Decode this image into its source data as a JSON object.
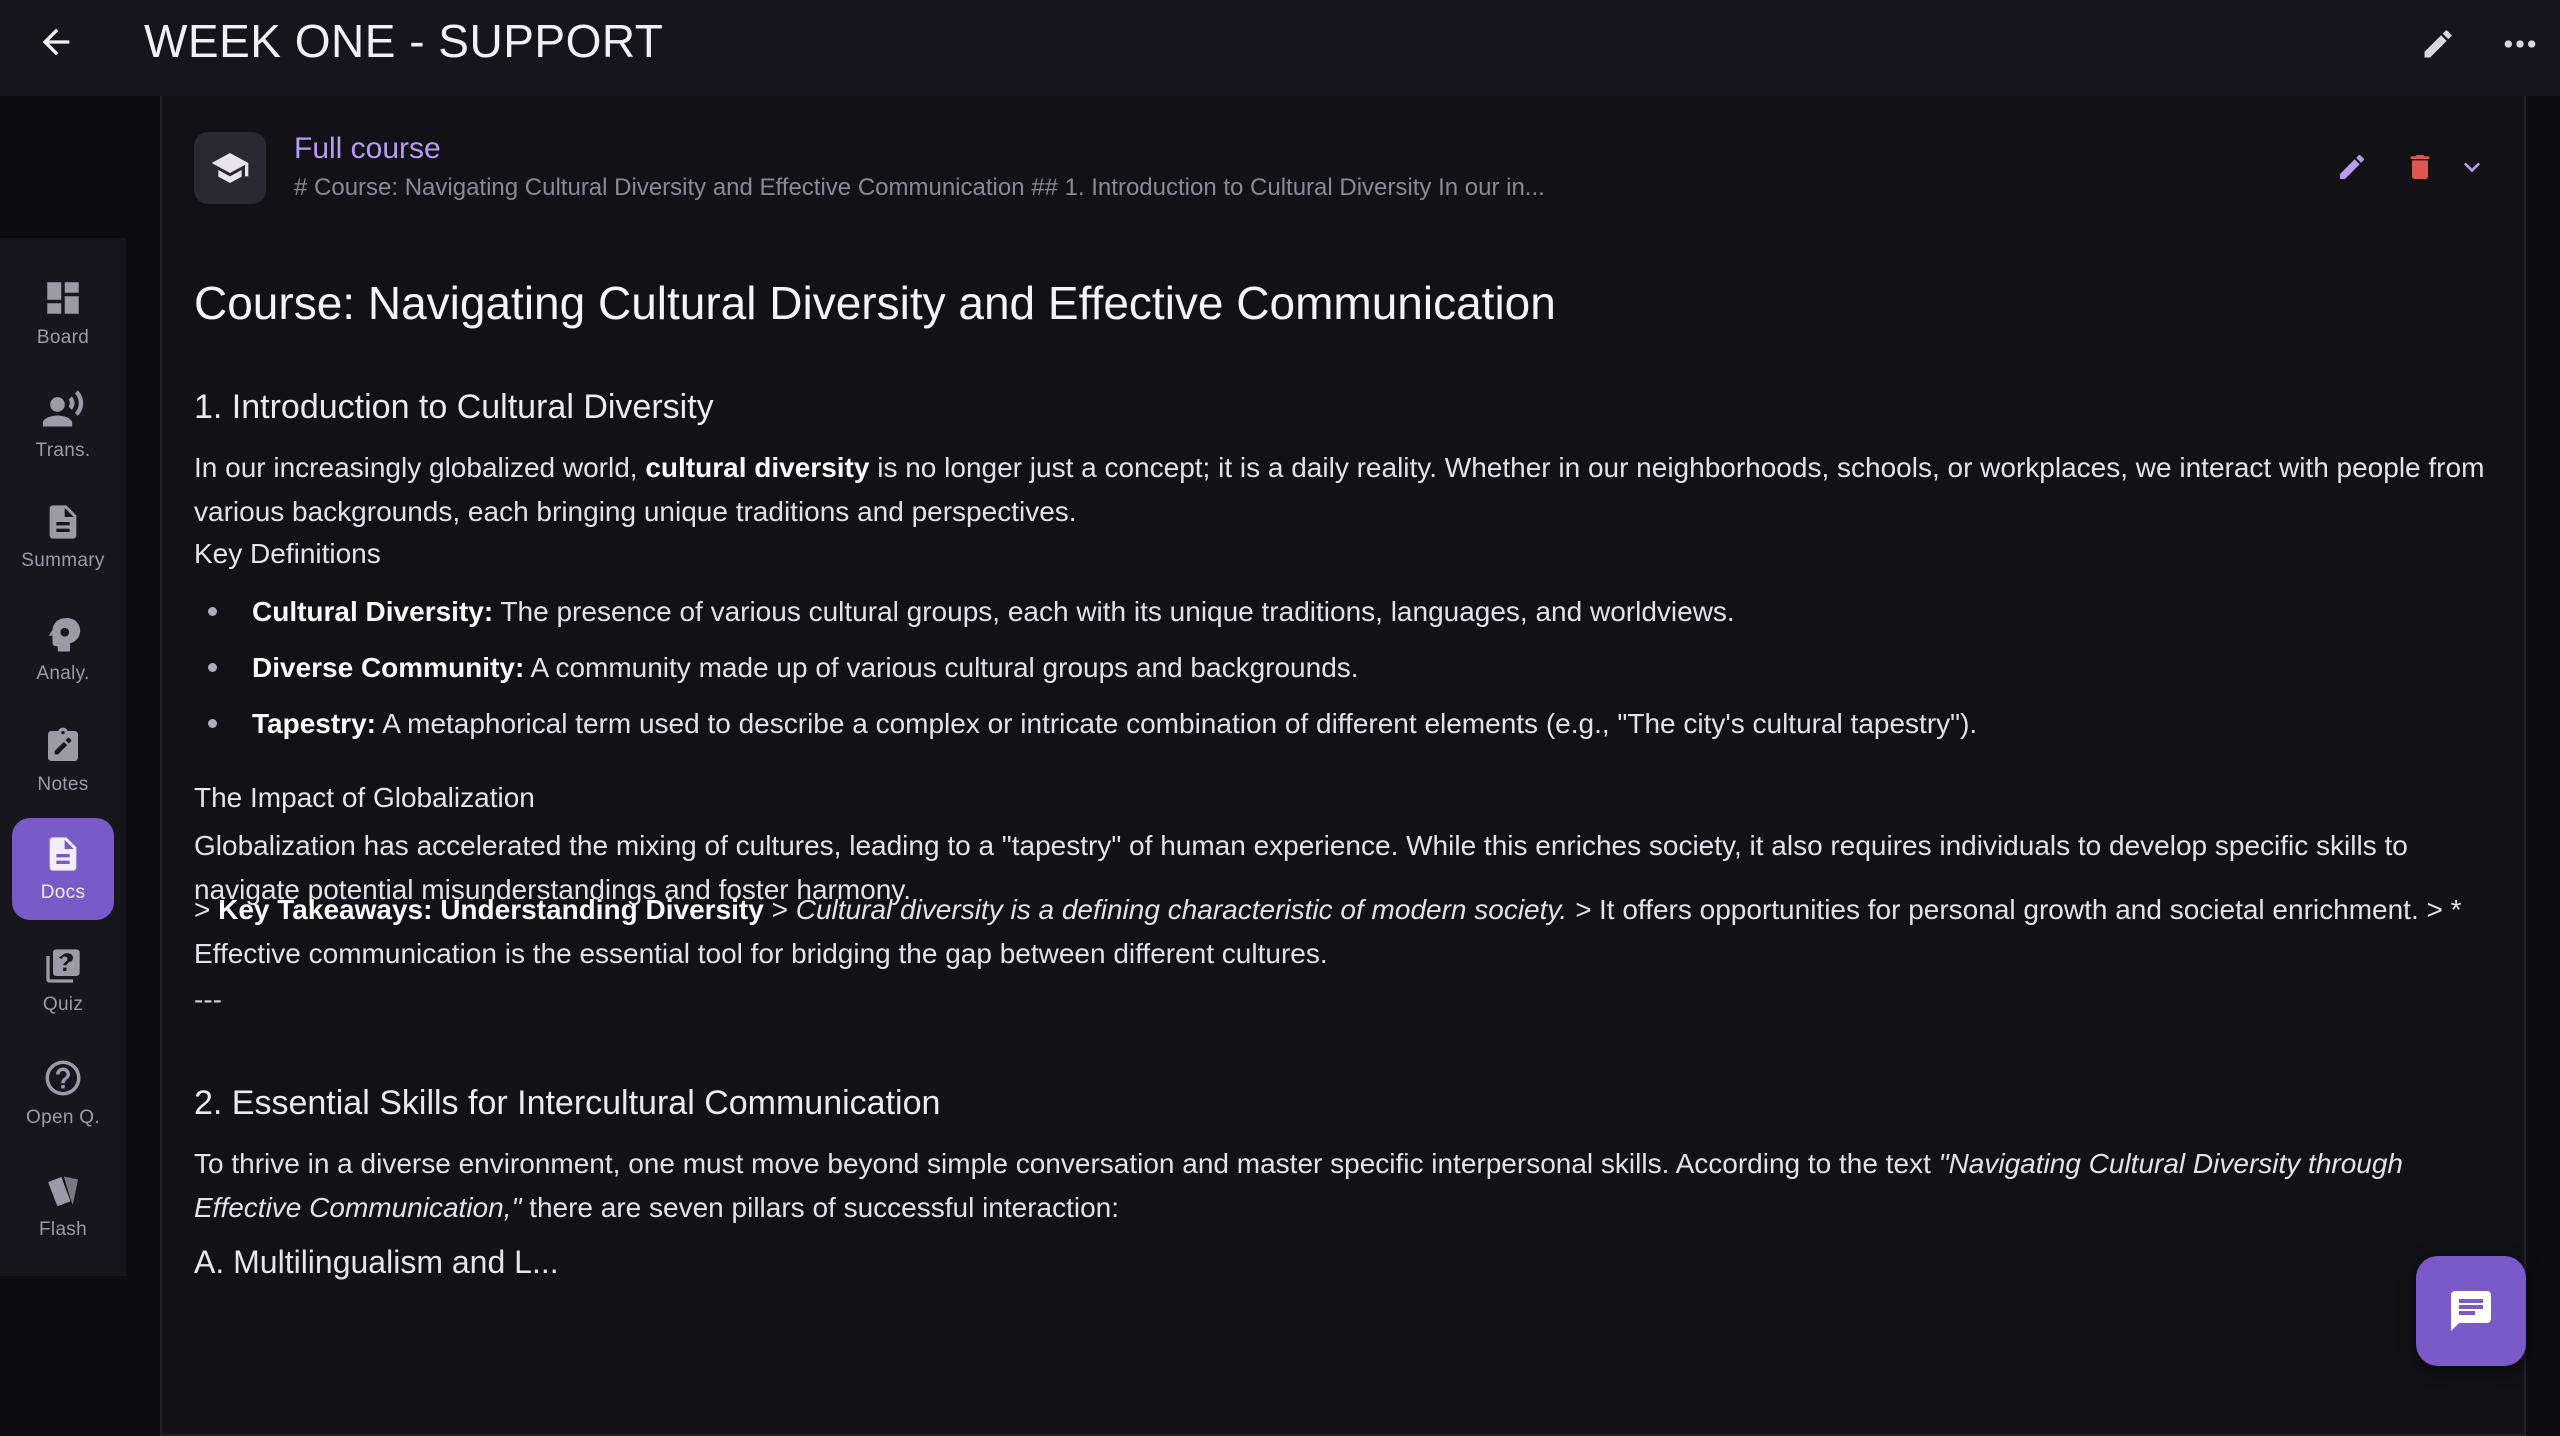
{
  "header": {
    "title": "WEEK ONE - SUPPORT"
  },
  "sidebar": {
    "items": [
      {
        "label": "Board",
        "icon": "dashboard-icon",
        "active": false
      },
      {
        "label": "Trans.",
        "icon": "voice-icon",
        "active": false
      },
      {
        "label": "Summary",
        "icon": "summary-doc-icon",
        "active": false
      },
      {
        "label": "Analy.",
        "icon": "brain-icon",
        "active": false
      },
      {
        "label": "Notes",
        "icon": "notes-icon",
        "active": false
      },
      {
        "label": "Docs",
        "icon": "docs-icon",
        "active": true
      },
      {
        "label": "Quiz",
        "icon": "quiz-icon",
        "active": false
      },
      {
        "label": "Open Q.",
        "icon": "question-icon",
        "active": false
      },
      {
        "label": "Flash",
        "icon": "flashcards-icon",
        "active": false
      }
    ]
  },
  "doc": {
    "title": "Full course",
    "snippet": "# Course: Navigating Cultural Diversity and Effective Communication  ## 1. Introduction to Cultural Diversity  In our in..."
  },
  "content": {
    "h1": "Course: Navigating Cultural Diversity and Effective Communication",
    "s1_title": "1. Introduction to Cultural Diversity",
    "s1_p_a": "In our increasingly globalized world, ",
    "s1_p_b": "cultural diversity",
    "s1_p_c": " is no longer just a concept; it is a daily reality. Whether in our neighborhoods, schools, or workplaces, we interact with people from various backgrounds, each bringing unique traditions and perspectives.",
    "kd_title": "Key Definitions",
    "bullets": [
      {
        "term": "Cultural Diversity:",
        "text": " The presence of various cultural groups, each with its unique traditions, languages, and worldviews."
      },
      {
        "term": "Diverse Community:",
        "text": " A community made up of various cultural groups and backgrounds."
      },
      {
        "term": "Tapestry:",
        "text": " A metaphorical term used to describe a complex or intricate combination of different elements (e.g., \"The city's cultural tapestry\")."
      }
    ],
    "glob_title": "The Impact of Globalization",
    "glob_p": "Globalization has accelerated the mixing of cultures, leading to a \"tapestry\" of human experience. While this enriches society, it also requires individuals to develop specific skills to navigate potential misunderstandings and foster harmony.",
    "kt_a": "> ",
    "kt_b": "Key Takeaways: Understanding Diversity",
    "kt_c": " >    ",
    "kt_d": "Cultural diversity is a defining characteristic of modern society. >",
    "kt_e": "    It offers opportunities for personal growth and societal enrichment. > *   Effective communication is the essential tool for bridging the gap between different cultures.",
    "hr": "---",
    "s2_title": "2. Essential Skills for Intercultural Communication",
    "s2_p_a": "To thrive in a diverse environment, one must move beyond simple conversation and master specific interpersonal skills. According to the text ",
    "s2_p_b": "\"Navigating Cultural Diversity through Effective Communication,\"",
    "s2_p_c": " there are seven pillars of successful interaction:",
    "s2_next": "A. Multilingualism and L..."
  }
}
